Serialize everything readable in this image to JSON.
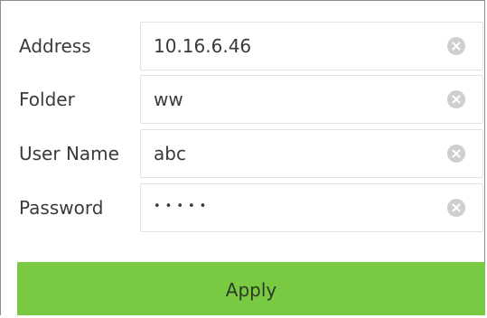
{
  "form": {
    "fields": [
      {
        "label": "Address",
        "value": "10.16.6.46",
        "icon": "clear-icon"
      },
      {
        "label": "Folder",
        "value": "ww",
        "icon": "clear-icon"
      },
      {
        "label": "User Name",
        "value": "abc",
        "icon": "clear-icon"
      },
      {
        "label": "Password",
        "value": "•••••",
        "icon": "clear-icon"
      }
    ],
    "apply_label": "Apply"
  },
  "colors": {
    "button": "#7ac943",
    "clear_icon": "#cfcfcf",
    "text": "#3a3a3a"
  }
}
